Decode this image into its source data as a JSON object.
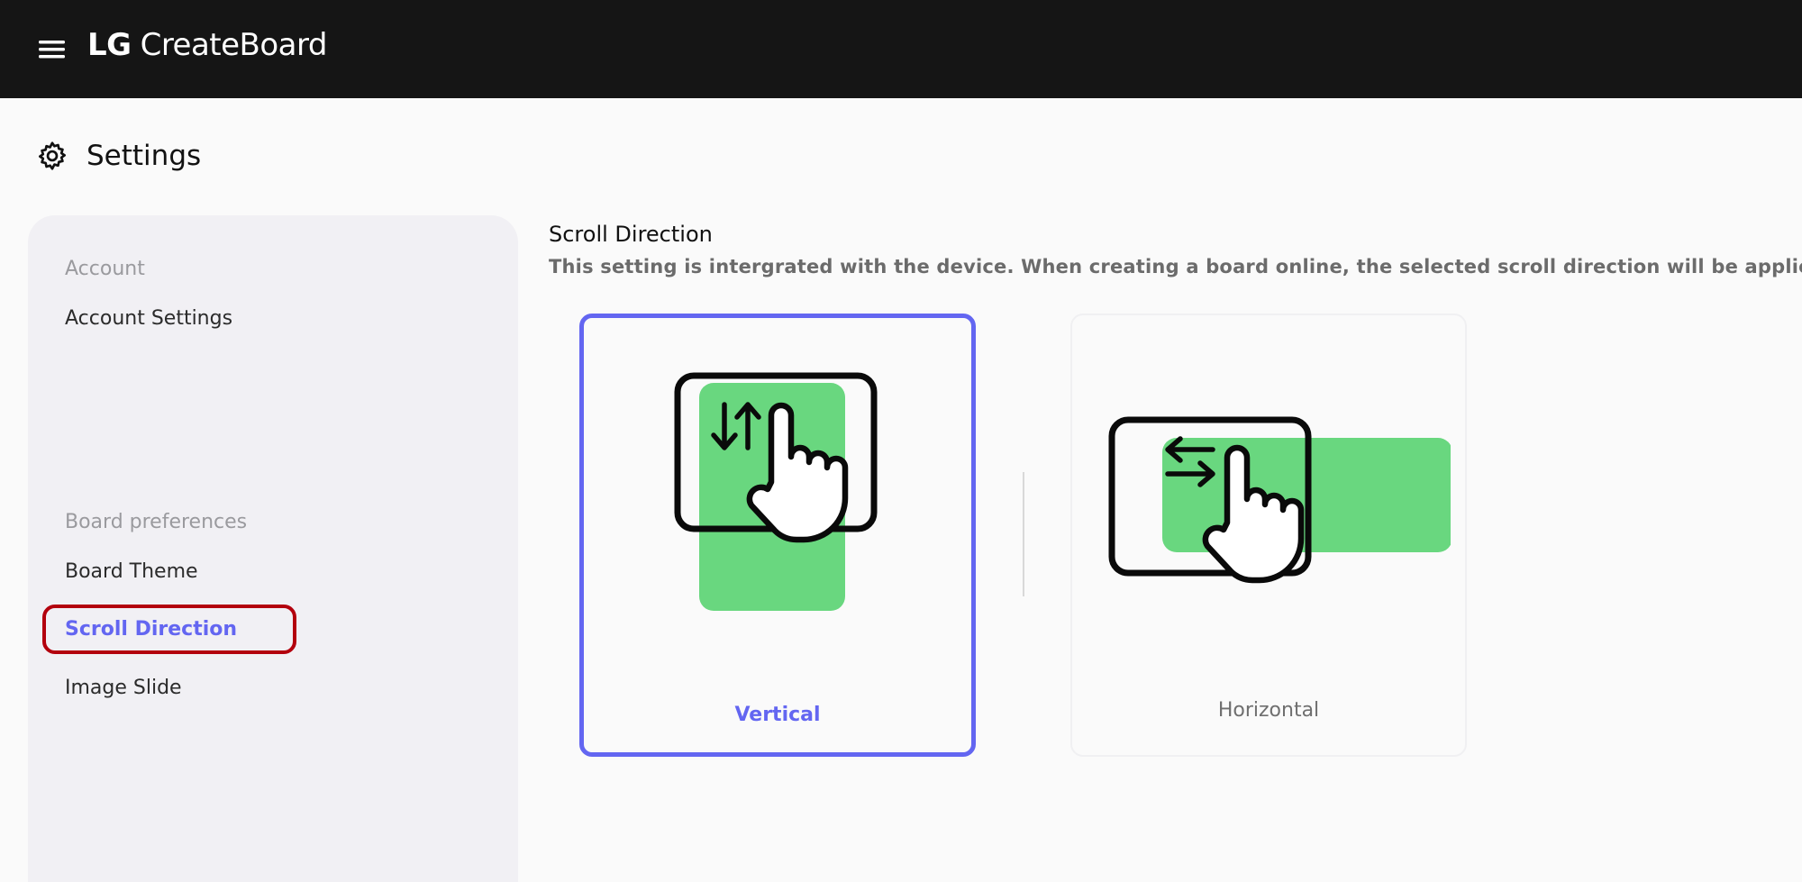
{
  "app": {
    "brand_lg": "LG",
    "brand_name": "CreateBoard"
  },
  "page": {
    "title": "Settings"
  },
  "sidebar": {
    "sections": [
      {
        "label": "Account",
        "items": [
          {
            "label": "Account Settings",
            "active": false
          }
        ]
      },
      {
        "label": "Board preferences",
        "items": [
          {
            "label": "Board Theme",
            "active": false
          },
          {
            "label": "Scroll Direction",
            "active": true
          },
          {
            "label": "Image Slide",
            "active": false
          }
        ]
      }
    ]
  },
  "content": {
    "title": "Scroll Direction",
    "description": "This setting is intergrated with the device. When creating a board online, the selected scroll direction will be applied.",
    "options": [
      {
        "label": "Vertical",
        "selected": true,
        "icon": "vertical-scroll-icon"
      },
      {
        "label": "Horizontal",
        "selected": false,
        "icon": "horizontal-scroll-icon"
      }
    ]
  },
  "colors": {
    "topbar": "#151515",
    "accent": "#6366f1",
    "sidebar_bg": "#f1f0f4",
    "illustration_green": "#69d77f",
    "highlight_ring": "#b3000d"
  }
}
